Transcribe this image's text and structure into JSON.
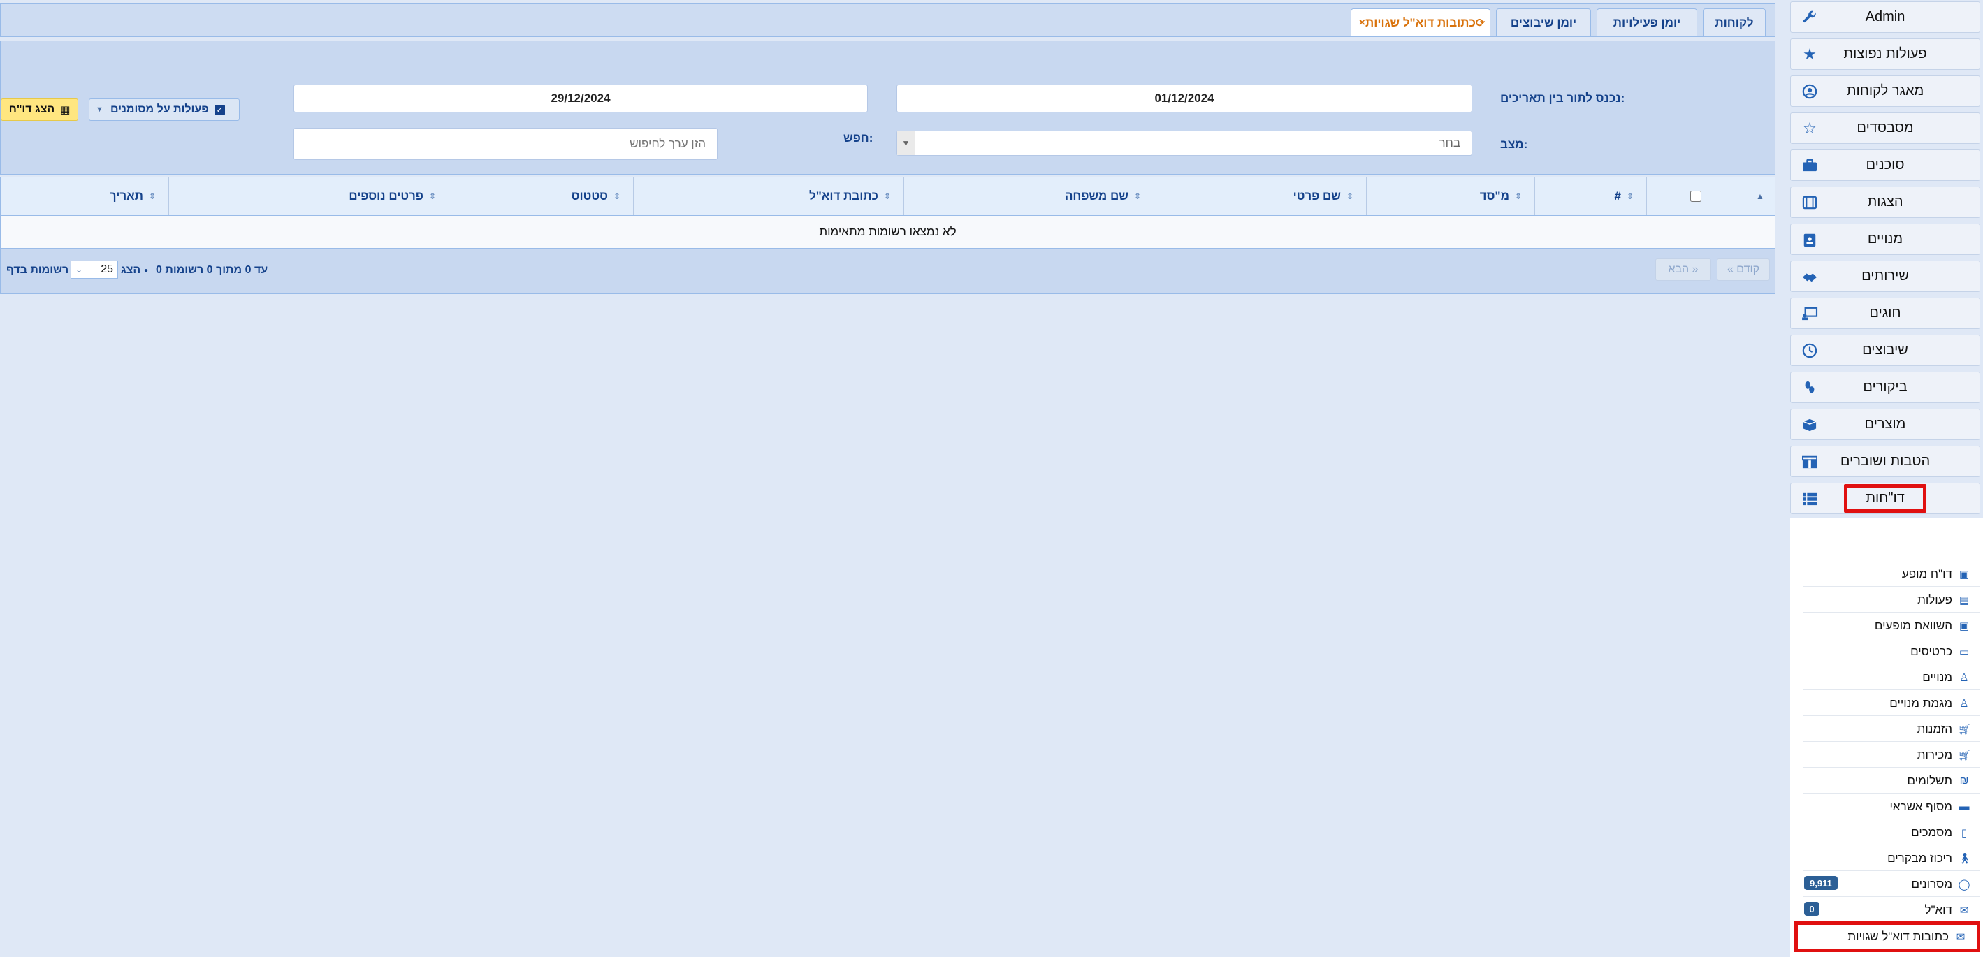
{
  "colors": {
    "accent": "#15428b",
    "active_tab": "#d9720b",
    "highlight": "#e01010",
    "badge": "#2c5f96"
  },
  "sidebar": {
    "items": [
      {
        "label": "Admin",
        "icon": "wrench-icon"
      },
      {
        "label": "פעולות נפוצות",
        "icon": "star-icon"
      },
      {
        "label": "מאגר לקוחות",
        "icon": "user-circle-icon"
      },
      {
        "label": "מסבסדים",
        "icon": "star-outline-icon"
      },
      {
        "label": "סוכנים",
        "icon": "briefcase-icon"
      },
      {
        "label": "הצגות",
        "icon": "film-icon"
      },
      {
        "label": "מנויים",
        "icon": "id-badge-icon"
      },
      {
        "label": "שירותים",
        "icon": "handshake-icon"
      },
      {
        "label": "חוגים",
        "icon": "chalkboard-icon"
      },
      {
        "label": "שיבוצים",
        "icon": "clock-icon"
      },
      {
        "label": "ביקורים",
        "icon": "footprints-icon"
      },
      {
        "label": "מוצרים",
        "icon": "box-icon"
      },
      {
        "label": "הטבות ושוברים",
        "icon": "gift-icon"
      },
      {
        "label": "דו\"חות",
        "icon": "list-icon"
      }
    ],
    "submenu": [
      {
        "label": "דו\"ח מופע",
        "icon": "film-icon"
      },
      {
        "label": "פעולות",
        "icon": "chart-icon"
      },
      {
        "label": "השוואת מופעים",
        "icon": "film-icon"
      },
      {
        "label": "כרטיסים",
        "icon": "ticket-icon"
      },
      {
        "label": "מנויים",
        "icon": "person-icon"
      },
      {
        "label": "מגמת מנויים",
        "icon": "person-icon"
      },
      {
        "label": "הזמנות",
        "icon": "cart-icon"
      },
      {
        "label": "מכירות",
        "icon": "cart-icon"
      },
      {
        "label": "תשלומים",
        "icon": "shekel-icon"
      },
      {
        "label": "מסוף אשראי",
        "icon": "credit-card-icon"
      },
      {
        "label": "מסמכים",
        "icon": "document-icon"
      },
      {
        "label": "ריכוז מבקרים",
        "icon": "walking-icon"
      },
      {
        "label": "מסרונים",
        "icon": "chat-icon",
        "badge": "9,911"
      },
      {
        "label": "דוא\"ל",
        "icon": "envelope-icon",
        "badge": "0"
      },
      {
        "label": "כתובות דוא\"ל שגויות",
        "icon": "envelope-icon"
      }
    ]
  },
  "tabs": [
    {
      "label": "לקוחות"
    },
    {
      "label": "יומן פעילויות"
    },
    {
      "label": "יומן שיבוצים"
    },
    {
      "label": "כתובות דוא\"ל שגויות",
      "close": "×"
    }
  ],
  "filter": {
    "date_range_label": "נכנס לתור בין תאריכים:",
    "date_from": "01/12/2024",
    "date_to": "29/12/2024",
    "status_label": "מצב:",
    "status_placeholder": "בחר",
    "search_label": "חפש:",
    "search_placeholder": "הזן ערך לחיפוש",
    "actions_label": "פעולות על מסומנים",
    "show_report_label": "הצג דו\"ח"
  },
  "grid": {
    "columns": [
      "#",
      "מ\"סד",
      "שם פרטי",
      "שם משפחה",
      "כתובת דוא\"ל",
      "סטטוס",
      "פרטים נוספים",
      "תאריך"
    ],
    "empty_text": "לא נמצאו רשומות מתאימות"
  },
  "pager": {
    "prev_label": "« קודם",
    "next_label": "הבא »",
    "summary": "0 עד 0 מתוך 0 רשומות",
    "show_label": "הצג",
    "page_size": "25",
    "per_page_label": "רשומות בדף"
  }
}
